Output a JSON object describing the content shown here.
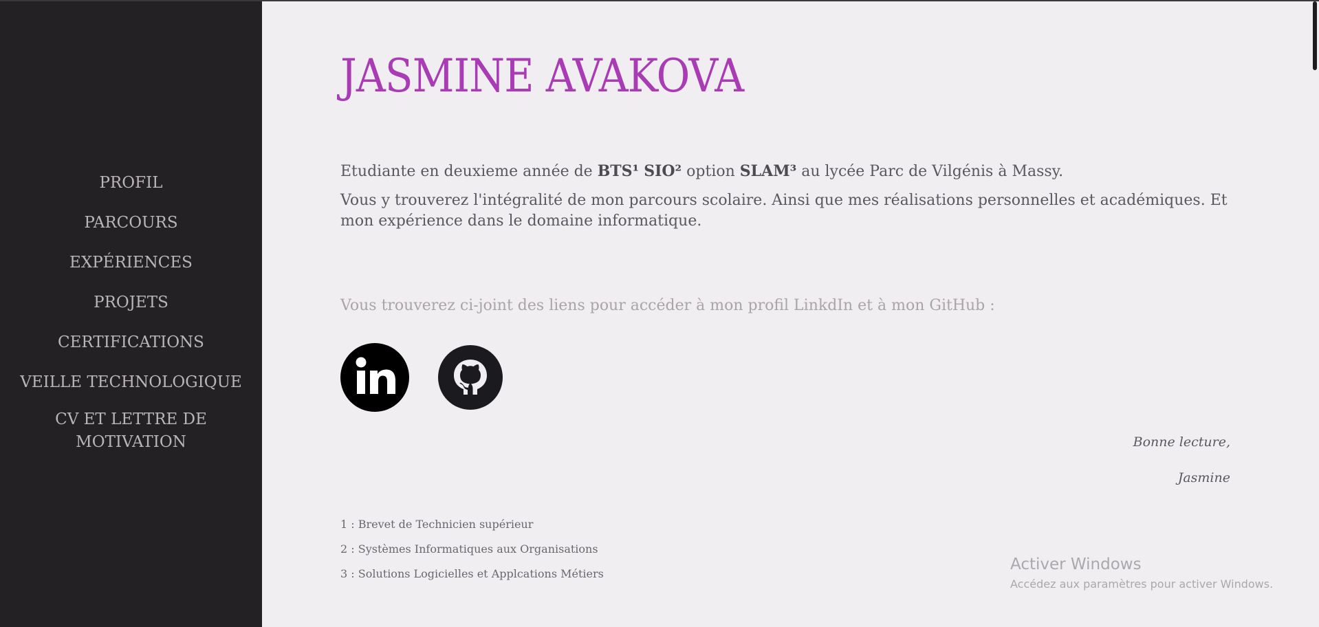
{
  "sidebar": {
    "items": [
      {
        "label": "PROFIL"
      },
      {
        "label": "PARCOURS"
      },
      {
        "label": "EXPÉRIENCES"
      },
      {
        "label": "PROJETS"
      },
      {
        "label": "CERTIFICATIONS"
      },
      {
        "label": "VEILLE TECHNOLOGIQUE"
      },
      {
        "label": "CV ET LETTRE DE MOTIVATION"
      }
    ]
  },
  "header": {
    "title": "JASMINE AVAKOVA"
  },
  "intro": {
    "p1_start": "Etudiante en deuxieme année de ",
    "bts": "BTS¹",
    "sio": "SIO²",
    "p1_option": " option ",
    "slam": "SLAM³",
    "p1_end": " au lycée Parc de Vilgénis à Massy.",
    "p2": "Vous y trouverez l'intégralité de mon parcours scolaire. Ainsi que mes réalisations personnelles et académiques. Et mon expérience dans le domaine informatique."
  },
  "links": {
    "text": "Vous trouverez ci-joint des liens pour accéder à mon profil LinkdIn et à mon GitHub :",
    "linkedin_icon": "linkedin-icon",
    "github_icon": "github-icon"
  },
  "signature": {
    "line1": "Bonne lecture,",
    "line2": "Jasmine"
  },
  "footnotes": [
    "1 : Brevet de Technicien supérieur",
    "2 : Systèmes Informatiques aux Organisations",
    "3 : Solutions Logicielles et Applcations Métiers"
  ],
  "watermark": {
    "title": "Activer Windows",
    "subtitle": "Accédez aux paramètres pour activer Windows."
  },
  "colors": {
    "sidebar_bg": "#232124",
    "page_bg": "#f0eef1",
    "accent": "#a93bb5",
    "nav_text": "#b9b5b8"
  }
}
